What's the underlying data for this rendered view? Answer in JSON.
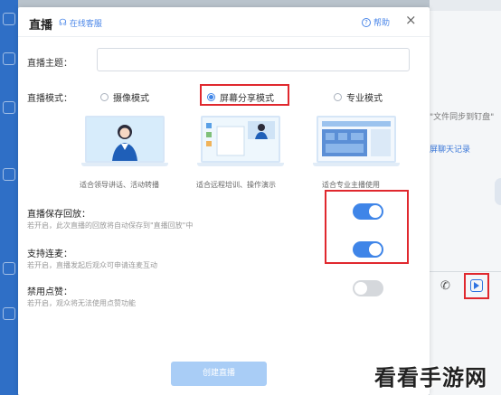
{
  "background": {
    "right_snippets": [
      "\"文件同步到钉盘\"",
      "屏聊天记录"
    ]
  },
  "dialog": {
    "title": "直播",
    "online_help": "在线客服",
    "help_label": "帮助",
    "close_glyph": "×",
    "topic_label": "直播主题：",
    "topic_value": "",
    "mode_label": "直播模式：",
    "modes": [
      {
        "label": "摄像模式",
        "selected": false
      },
      {
        "label": "屏幕分享模式",
        "selected": true
      },
      {
        "label": "专业模式",
        "selected": false
      }
    ],
    "captions": [
      "适合领导讲话、活动转播",
      "适合远程培训、操作演示",
      "适合专业主播使用"
    ],
    "settings": [
      {
        "title": "直播保存回放：",
        "desc": "若开启，此次直播的回放将自动保存到\"直播回放\"中",
        "enabled": true
      },
      {
        "title": "支持连麦：",
        "desc": "若开启，直播发起后观众可申请连麦互动",
        "enabled": true
      },
      {
        "title": "禁用点赞：",
        "desc": "若开启，观众将无法使用点赞功能",
        "enabled": false
      }
    ],
    "create_button": "创建直播"
  },
  "watermark": "看看手游网",
  "colors": {
    "accent": "#3f85e8",
    "highlight": "#e0282e",
    "button_disabled": "#a9cdf6"
  }
}
